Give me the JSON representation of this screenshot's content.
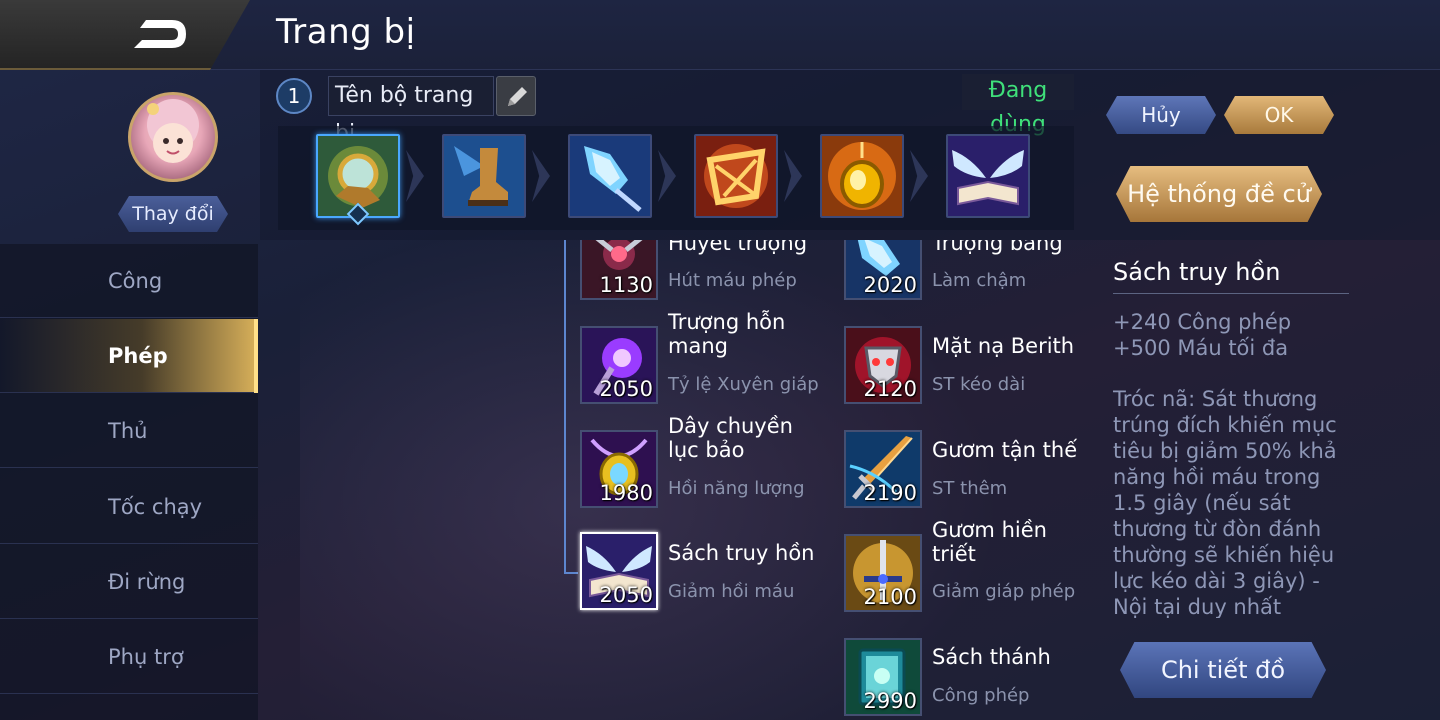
{
  "header": {
    "title": "Trang bị",
    "back_icon": "back-arrow-icon"
  },
  "equipment_set": {
    "number": "1",
    "name": "Tên bộ trang bị",
    "status": "Đang dùng",
    "slots": [
      {
        "icon": "compass-gauntlet-item-icon"
      },
      {
        "icon": "winged-boots-item-icon"
      },
      {
        "icon": "frost-staff-item-icon"
      },
      {
        "icon": "golden-mask-item-icon"
      },
      {
        "icon": "gold-pendant-item-icon"
      },
      {
        "icon": "winged-book-item-icon"
      }
    ]
  },
  "hero": {
    "change_label": "Thay đổi"
  },
  "actions": {
    "cancel_label": "Hủy",
    "ok_label": "OK",
    "recommend_label": "Hệ thống đề cử",
    "detail_label": "Chi tiết đồ"
  },
  "categories": [
    {
      "label": "Công",
      "active": false
    },
    {
      "label": "Phép",
      "active": true
    },
    {
      "label": "Thủ",
      "active": false
    },
    {
      "label": "Tốc chạy",
      "active": false
    },
    {
      "label": "Đi rừng",
      "active": false
    },
    {
      "label": "Phụ trợ",
      "active": false
    }
  ],
  "items_left": [
    {
      "name": "Huyết trượng",
      "desc": "Hút máu phép",
      "price": "1130"
    },
    {
      "name": "Trượng hỗn mang",
      "desc": "Tỷ lệ Xuyên giáp",
      "price": "2050"
    },
    {
      "name": "Dây chuyền lục bảo",
      "desc": "Hồi năng lượng",
      "price": "1980"
    },
    {
      "name": "Sách truy hồn",
      "desc": "Giảm hồi máu",
      "price": "2050"
    }
  ],
  "items_right": [
    {
      "name": "Trượng băng",
      "desc": "Làm chậm",
      "price": "2020"
    },
    {
      "name": "Mặt nạ Berith",
      "desc": "ST kéo dài",
      "price": "2120"
    },
    {
      "name": "Gươm tận thế",
      "desc": "ST thêm",
      "price": "2190"
    },
    {
      "name": "Gươm hiền triết",
      "desc": "Giảm giáp phép",
      "price": "2100"
    },
    {
      "name": "Sách thánh",
      "desc": "Công phép",
      "price": "2990"
    }
  ],
  "detail": {
    "title": "Sách truy hồn",
    "stat1": "+240 Công phép",
    "stat2": "+500 Máu tối đa",
    "passive": "Tróc nã: Sát thương trúng đích khiến mục tiêu bị giảm 50% khả năng hồi máu trong 1.5 giây (nếu sát thương từ đòn đánh thường sẽ khiến hiệu lực kéo dài 3 giây) - Nội tại duy nhất"
  }
}
